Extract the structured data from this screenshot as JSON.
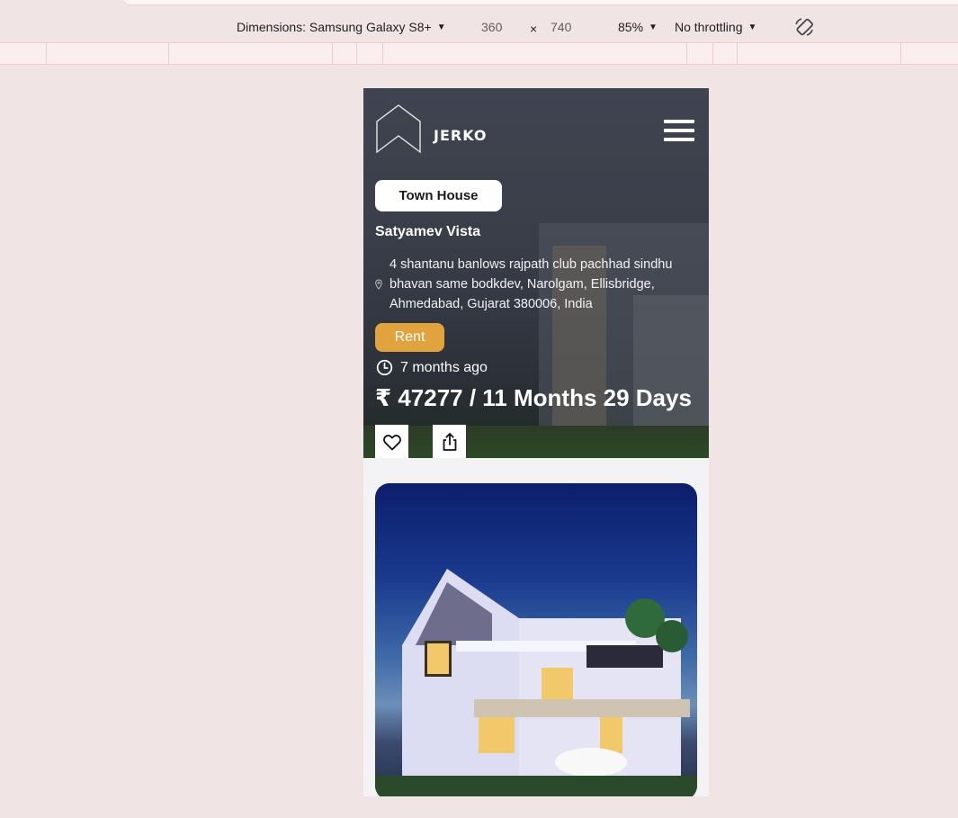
{
  "devtools_toolbar": {
    "dimensions_label": "Dimensions: Samsung Galaxy S8+",
    "width": "360",
    "times": "×",
    "height": "740",
    "zoom": "85%",
    "throttling": "No throttling",
    "caret": "▼",
    "rotate_icon": "rotate-icon"
  },
  "app": {
    "brand": "JERKO",
    "logo_icon": "house-outline-logo",
    "menu_icon": "hamburger-icon"
  },
  "property": {
    "type": "Town House",
    "title": "Satyamev Vista",
    "address": "4 shantanu banlows rajpath club pachhad sindhu bhavan same bodkdev, Narolgam, Ellisbridge, Ahmedabad, Gujarat 380006, India",
    "listing": "Rent",
    "posted": "7 months ago",
    "price": "₹ 47277 / 11 Months 29 Days",
    "accent_color": "#e0a33e"
  },
  "actions": {
    "favorite_icon": "heart-icon",
    "share_icon": "share-icon"
  }
}
